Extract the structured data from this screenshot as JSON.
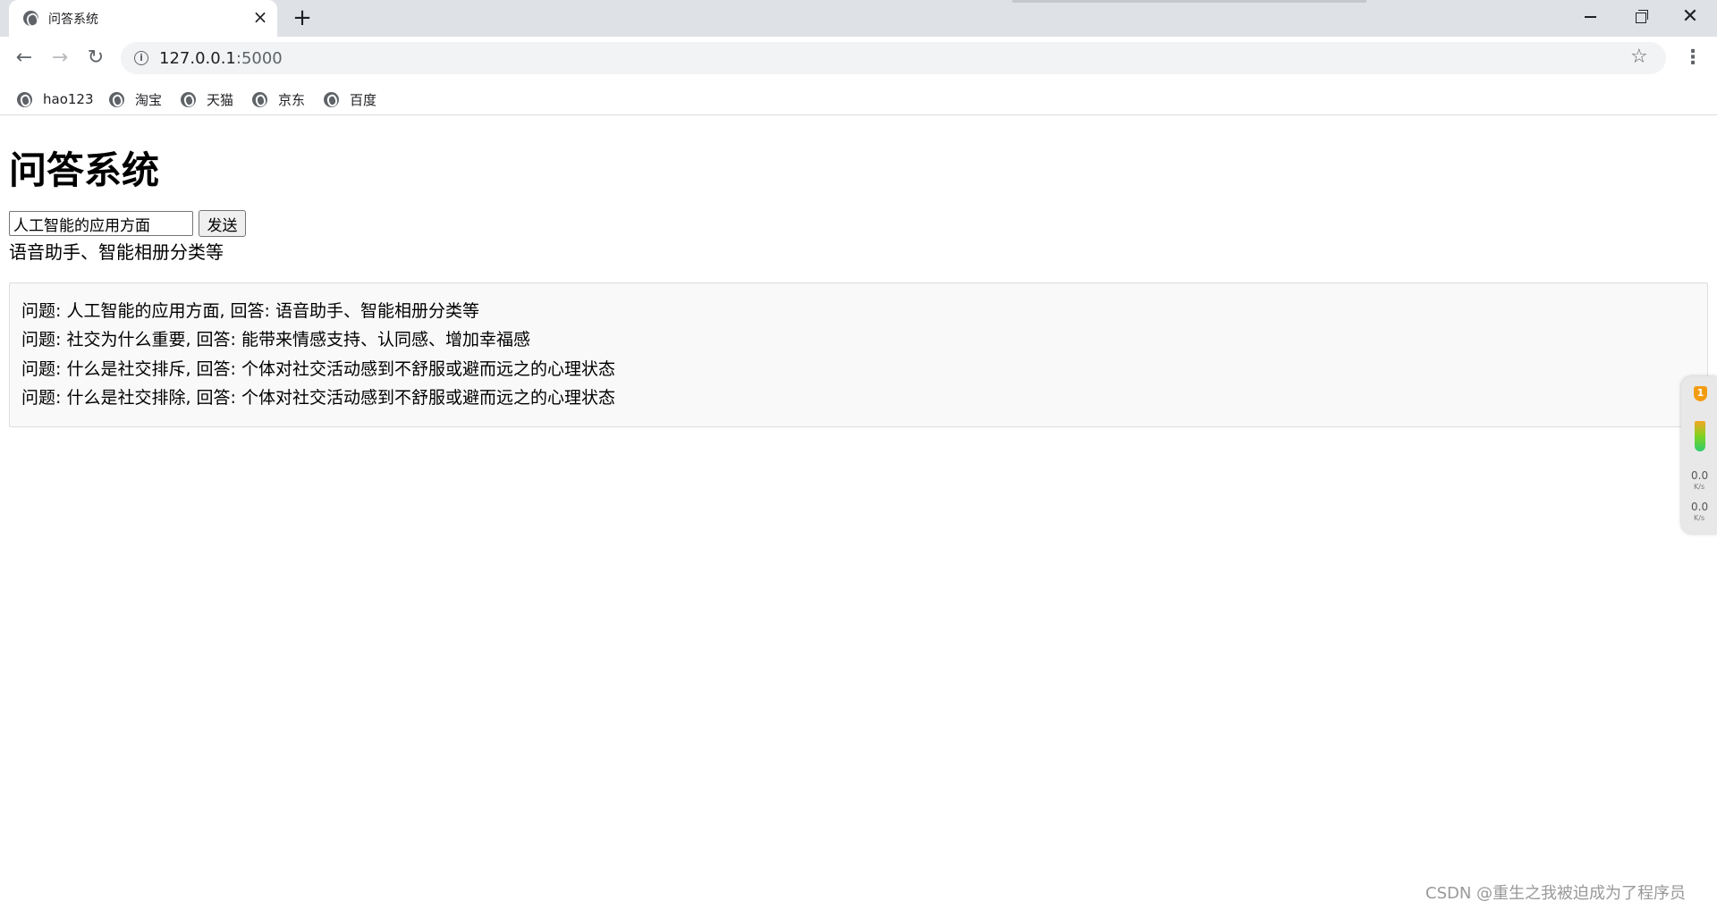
{
  "browser": {
    "tab_title": "问答系统",
    "tab_close": "×",
    "new_tab": "+",
    "url_host": "127.0.0.1",
    "url_port": ":5000",
    "bookmarks": [
      "hao123",
      "淘宝",
      "天猫",
      "京东",
      "百度"
    ]
  },
  "page": {
    "title": "问答系统",
    "input_value": "人工智能的应用方面",
    "send_label": "发送",
    "answer": "语音助手、智能相册分类等",
    "history": [
      "问题: 人工智能的应用方面, 回答: 语音助手、智能相册分类等",
      "问题: 社交为什么重要, 回答: 能带来情感支持、认同感、增加幸福感",
      "问题: 什么是社交排斥, 回答: 个体对社交活动感到不舒服或避而远之的心理状态",
      "问题: 什么是社交排除, 回答: 个体对社交活动感到不舒服或避而远之的心理状态"
    ]
  },
  "side_widget": {
    "badge": "1",
    "upload_speed": "0.0",
    "upload_unit": "K/s",
    "download_speed": "0.0",
    "download_unit": "K/s"
  },
  "watermark": "CSDN @重生之我被迫成为了程序员"
}
